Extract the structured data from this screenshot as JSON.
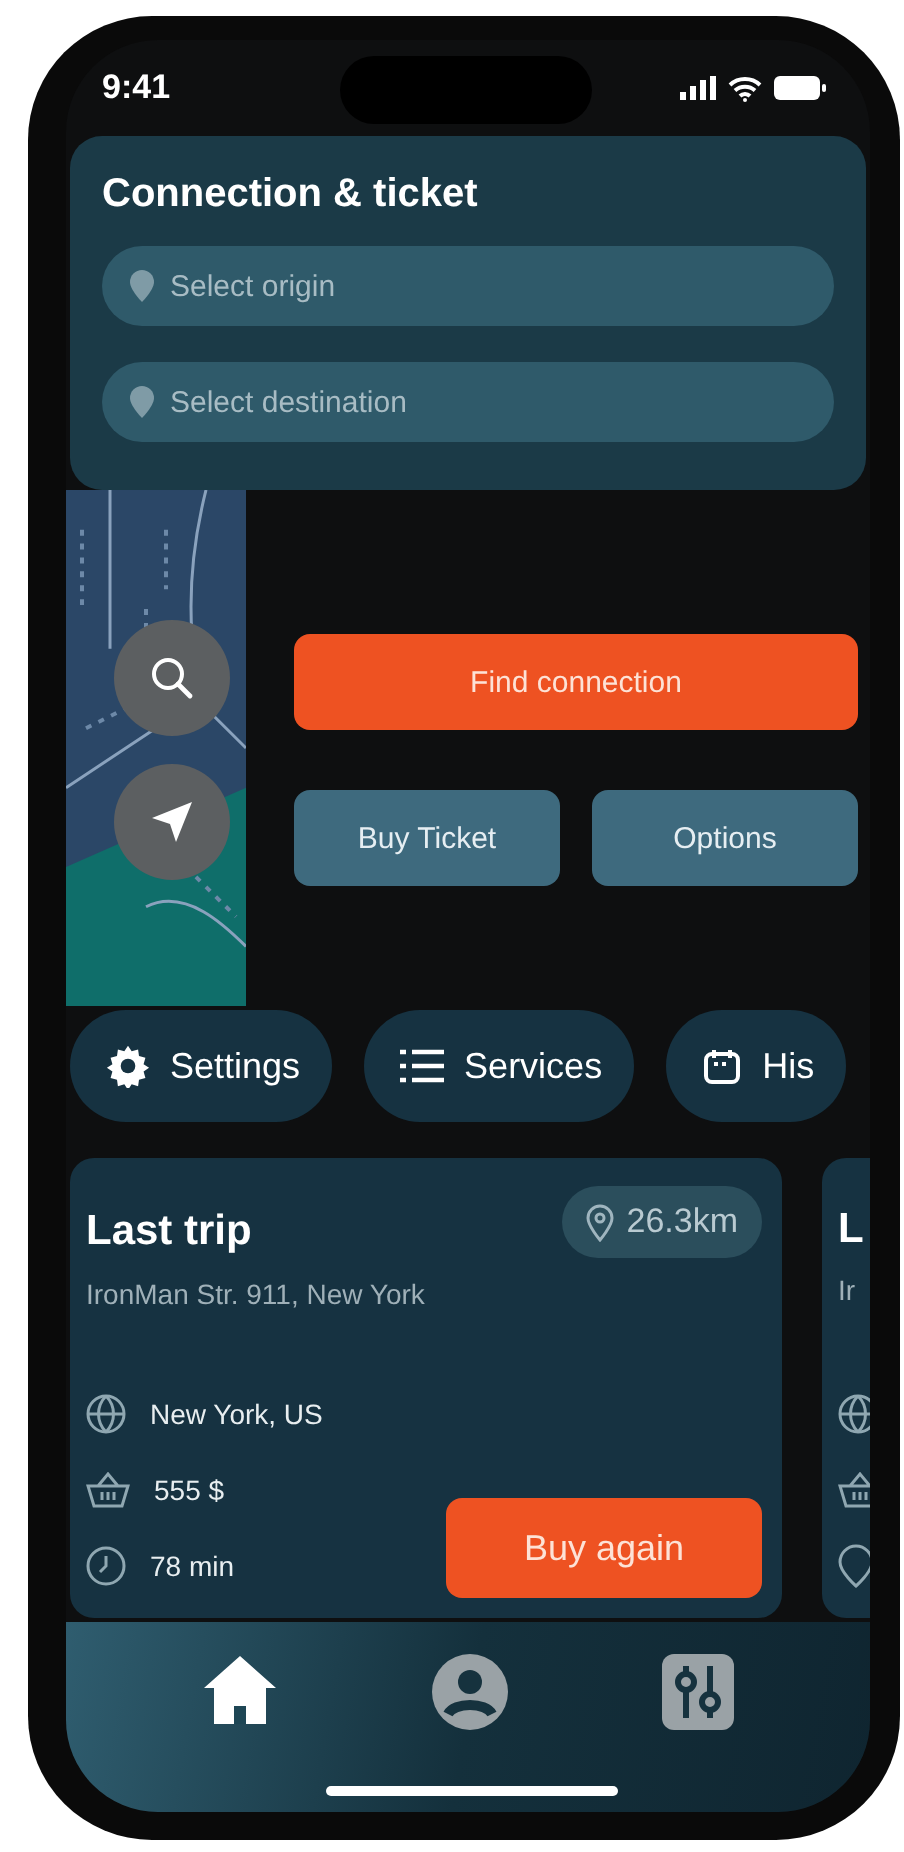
{
  "status_bar": {
    "time": "9:41"
  },
  "header": {
    "title": "Connection & ticket",
    "fields": [
      {
        "placeholder": "Select origin"
      },
      {
        "placeholder": "Select destination"
      }
    ]
  },
  "actions": {
    "primary": "Find connection",
    "secondary": [
      "Buy Ticket",
      "Options"
    ]
  },
  "chips": [
    {
      "label": "Settings",
      "kind": "settings"
    },
    {
      "label": "Services",
      "kind": "list"
    },
    {
      "label": "His",
      "kind": "calendar"
    }
  ],
  "trips": [
    {
      "title": "Last trip",
      "address": "IronMan Str. 911, New York",
      "distance": "26.3km",
      "details": [
        {
          "kind": "globe",
          "text": "New York, US"
        },
        {
          "kind": "basket",
          "text": "555 $"
        },
        {
          "kind": "clock",
          "text": "78 min"
        }
      ],
      "button": "Buy again"
    },
    {
      "title": "L",
      "address": "Ir",
      "details": [
        {
          "kind": "globe"
        },
        {
          "kind": "basket"
        },
        {
          "kind": "pin"
        }
      ]
    }
  ],
  "nav": [
    {
      "kind": "home",
      "selected": true
    },
    {
      "kind": "profile",
      "selected": false
    },
    {
      "kind": "sliders",
      "selected": false
    }
  ]
}
